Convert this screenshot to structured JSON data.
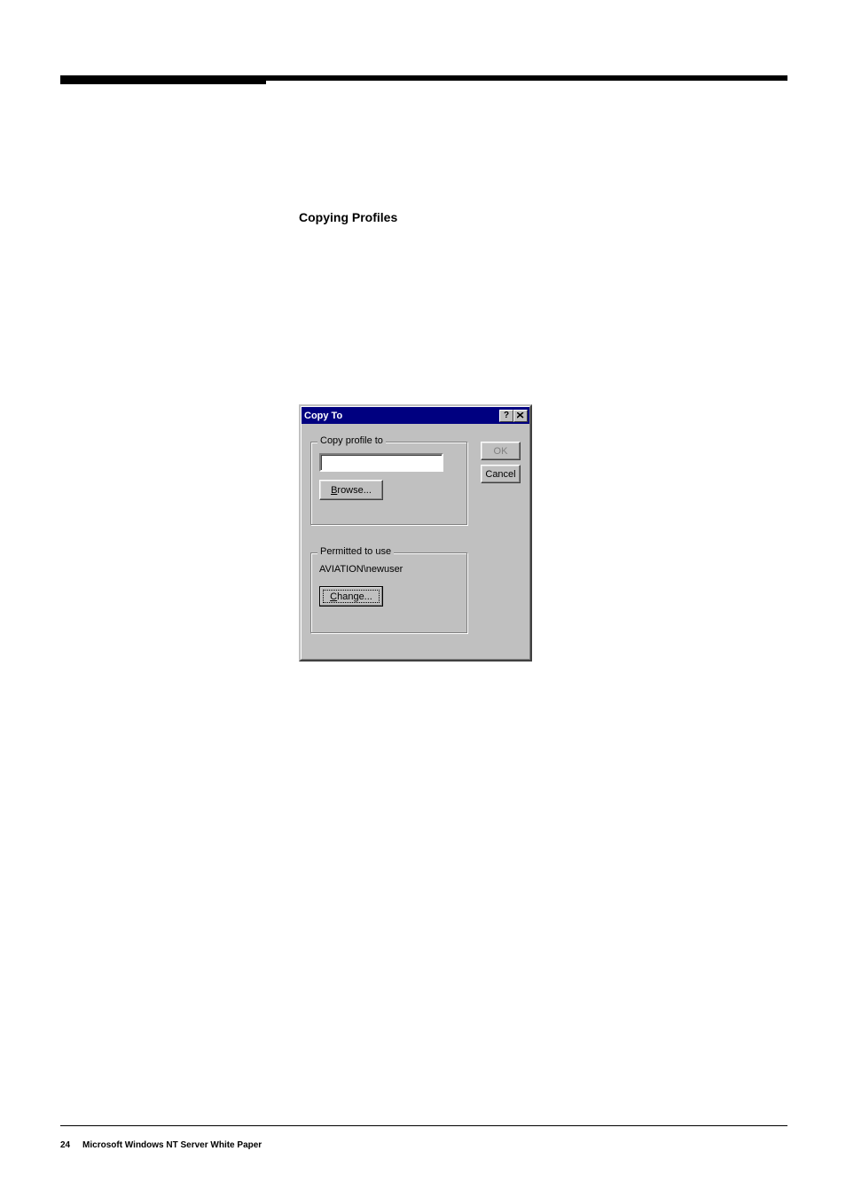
{
  "section_title": "Copying Profiles",
  "dialog": {
    "title": "Copy To",
    "copy_profile": {
      "legend": "Copy profile to",
      "input_value": "",
      "browse_label": "Browse..."
    },
    "permitted": {
      "legend": "Permitted to use",
      "user": "AVIATION\\newuser",
      "change_label": "Change..."
    },
    "ok_label": "OK",
    "cancel_label": "Cancel"
  },
  "footer": {
    "page": "24",
    "text": "Microsoft Windows NT Server White Paper"
  }
}
